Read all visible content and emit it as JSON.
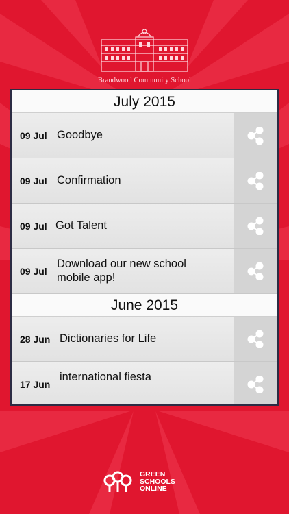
{
  "school": {
    "name": "Brandwood Community School"
  },
  "sections": [
    {
      "month": "July 2015",
      "items": [
        {
          "date": "09 Jul",
          "title": "Goodbye"
        },
        {
          "date": "09 Jul",
          "title": "Confirmation"
        },
        {
          "date": "09 Jul",
          "title": "Got Talent"
        },
        {
          "date": "09 Jul",
          "title": "Download our new school mobile app!"
        }
      ]
    },
    {
      "month": "June 2015",
      "items": [
        {
          "date": "28 Jun",
          "title": "Dictionaries for Life"
        },
        {
          "date": "17 Jun",
          "title": "international fiesta"
        }
      ]
    }
  ],
  "footer": {
    "line1": "GREEN",
    "line2": "SCHOOLS",
    "line3": "ONLINE"
  },
  "icons": {
    "share": "share-icon",
    "logo": "green-schools-logo-icon",
    "building": "school-building-icon"
  },
  "colors": {
    "background": "#e0162f",
    "panel": "#f4f4f4",
    "share_bg": "#d4d4d4"
  }
}
